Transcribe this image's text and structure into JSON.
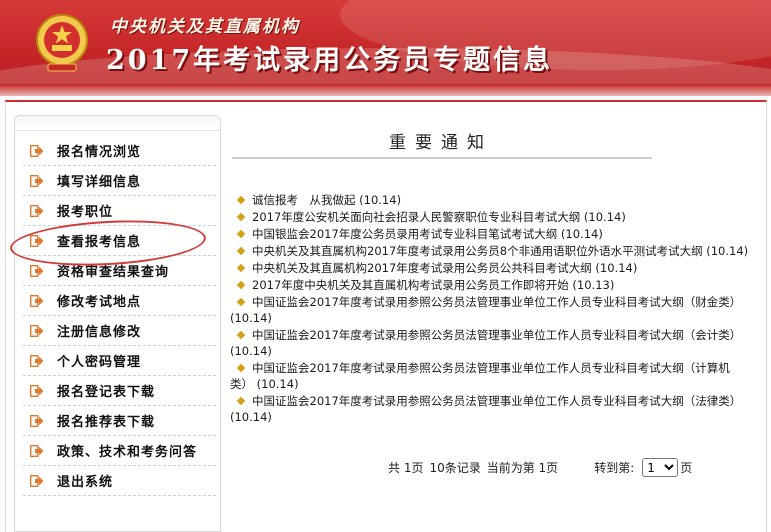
{
  "header": {
    "subtitle": "中央机关及其直属机构",
    "title": "2017年考试录用公务员专题信息"
  },
  "colors": {
    "accent": "#c9302c",
    "bullet": "#d4a017",
    "arrow": "#e07a2e"
  },
  "sidebar": {
    "items": [
      {
        "label": "报名情况浏览",
        "icon": "arrow-icon"
      },
      {
        "label": "填写详细信息",
        "icon": "arrow-icon"
      },
      {
        "label": "报考职位",
        "icon": "arrow-icon"
      },
      {
        "label": "查看报考信息",
        "icon": "arrow-icon",
        "highlighted": true
      },
      {
        "label": "资格审查结果查询",
        "icon": "arrow-icon"
      },
      {
        "label": "修改考试地点",
        "icon": "arrow-icon"
      },
      {
        "label": "注册信息修改",
        "icon": "arrow-icon"
      },
      {
        "label": "个人密码管理",
        "icon": "arrow-icon"
      },
      {
        "label": "报名登记表下载",
        "icon": "arrow-icon"
      },
      {
        "label": "报名推荐表下载",
        "icon": "arrow-icon"
      },
      {
        "label": "政策、技术和考务问答",
        "icon": "arrow-icon"
      },
      {
        "label": "退出系统",
        "icon": "arrow-icon"
      }
    ]
  },
  "main": {
    "notice_title": "重要通知",
    "news": [
      {
        "title": "诚信报考　从我做起",
        "date": "(10.14)"
      },
      {
        "title": "2017年度公安机关面向社会招录人民警察职位专业科目考试大纲",
        "date": "(10.14)"
      },
      {
        "title": "中国银监会2017年度公务员录用考试专业科目笔试考试大纲",
        "date": "(10.14)"
      },
      {
        "title": "中央机关及其直属机构2017年度考试录用公务员8个非通用语职位外语水平测试考试大纲",
        "date": "(10.14)"
      },
      {
        "title": "中央机关及其直属机构2017年度考试录用公务员公共科目考试大纲",
        "date": "(10.14)"
      },
      {
        "title": "2017年度中央机关及其直属机构考试录用公务员工作即将开始",
        "date": "(10.13)"
      },
      {
        "title": "中国证监会2017年度考试录用参照公务员法管理事业单位工作人员专业科目考试大纲（财金类）",
        "date": "(10.14)"
      },
      {
        "title": "中国证监会2017年度考试录用参照公务员法管理事业单位工作人员专业科目考试大纲（会计类）",
        "date": "(10.14)"
      },
      {
        "title": "中国证监会2017年度考试录用参照公务员法管理事业单位工作人员专业科目考试大纲（计算机类）",
        "date": "(10.14)"
      },
      {
        "title": "中国证监会2017年度考试录用参照公务员法管理事业单位工作人员专业科目考试大纲（法律类）",
        "date": "(10.14)"
      }
    ],
    "pager": {
      "total_pages": "共 1页",
      "total_records": "10条记录",
      "current_page": "当前为第 1页",
      "goto_label": "转到第:",
      "goto_value": "1",
      "goto_suffix": "页"
    }
  }
}
